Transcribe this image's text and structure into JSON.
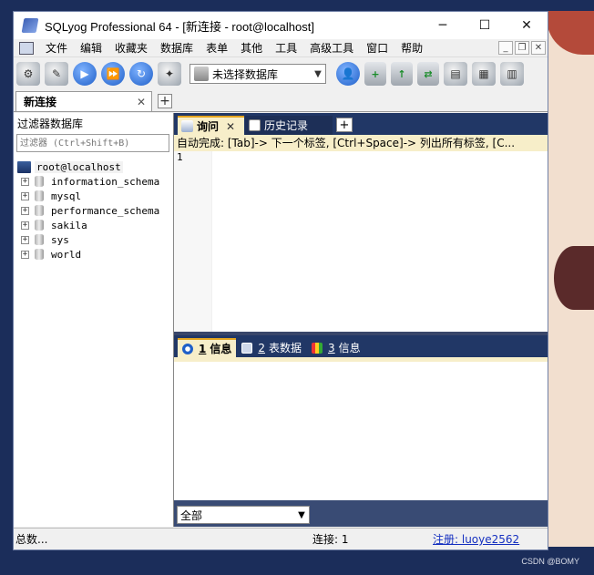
{
  "window": {
    "title": "SQLyog Professional 64 - [新连接 - root@localhost]",
    "minimize": "─",
    "maximize": "☐",
    "close": "✕"
  },
  "menu": [
    "文件",
    "编辑",
    "收藏夹",
    "数据库",
    "表单",
    "其他",
    "工具",
    "高级工具",
    "窗口",
    "帮助"
  ],
  "mdi": {
    "minimize": "_",
    "restore": "❐",
    "close": "✕"
  },
  "toolbar": {
    "db_select": "未选择数据库"
  },
  "connection_tab": {
    "label": "新连接",
    "close": "✕",
    "add": "+"
  },
  "left": {
    "filter_title": "过滤器数据库",
    "filter_placeholder": "过滤器 (Ctrl+Shift+B)",
    "root": "root@localhost",
    "databases": [
      "information_schema",
      "mysql",
      "performance_schema",
      "sakila",
      "sys",
      "world"
    ]
  },
  "query_tabs": {
    "query": "询问",
    "history": "历史记录",
    "add": "+"
  },
  "autocomplete_hint": "自动完成: [Tab]-> 下一个标签, [Ctrl+Space]-> 列出所有标签, [C...",
  "editor": {
    "line": "1"
  },
  "result_tabs": [
    {
      "num": "1",
      "label": "信息"
    },
    {
      "num": "2",
      "label": "表数据"
    },
    {
      "num": "3",
      "label": "信息"
    }
  ],
  "result_filter": "全部",
  "status": {
    "left": "总数...",
    "connection": "连接: 1",
    "register": "注册:  luoye2562"
  },
  "watermark": "CSDN @BOMY"
}
